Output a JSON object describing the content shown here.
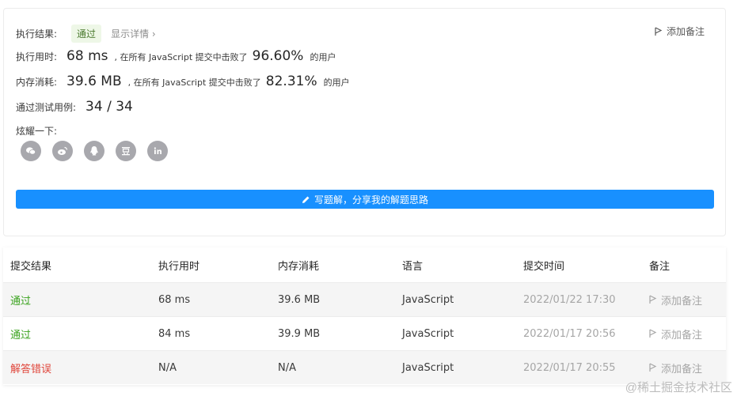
{
  "result": {
    "label": "执行结果:",
    "status": "通过",
    "detail_link": "显示详情 ›",
    "add_note": "添加备注"
  },
  "runtime": {
    "label": "执行用时:",
    "value": "68 ms",
    "text": ", 在所有 JavaScript 提交中击败了",
    "percent": "96.60%",
    "suffix": "的用户"
  },
  "memory": {
    "label": "内存消耗:",
    "value": "39.6 MB",
    "text": ", 在所有 JavaScript 提交中击败了",
    "percent": "82.31%",
    "suffix": "的用户"
  },
  "tests": {
    "label": "通过测试用例:",
    "value": "34 / 34"
  },
  "share": {
    "label": "炫耀一下:",
    "icons": [
      "wechat-icon",
      "weibo-icon",
      "qq-icon",
      "douban-icon",
      "linkedin-icon"
    ]
  },
  "write_button": "写题解，分享我的解题思路",
  "table": {
    "headers": [
      "提交结果",
      "执行用时",
      "内存消耗",
      "语言",
      "提交时间",
      "备注"
    ],
    "rows": [
      {
        "result": "通过",
        "result_type": "ok",
        "time": "68 ms",
        "memory": "39.6 MB",
        "lang": "JavaScript",
        "submitted": "2022/01/22 17:30",
        "note": "添加备注"
      },
      {
        "result": "通过",
        "result_type": "ok",
        "time": "84 ms",
        "memory": "39.9 MB",
        "lang": "JavaScript",
        "submitted": "2022/01/17 20:56",
        "note": "添加备注"
      },
      {
        "result": "解答错误",
        "result_type": "err",
        "time": "N/A",
        "memory": "N/A",
        "lang": "JavaScript",
        "submitted": "2022/01/17 20:55",
        "note": "添加备注"
      }
    ]
  },
  "watermark": "@稀土掘金技术社区",
  "colors": {
    "accent": "#1890ff",
    "success": "#3ba31f",
    "error": "#e0453a"
  }
}
